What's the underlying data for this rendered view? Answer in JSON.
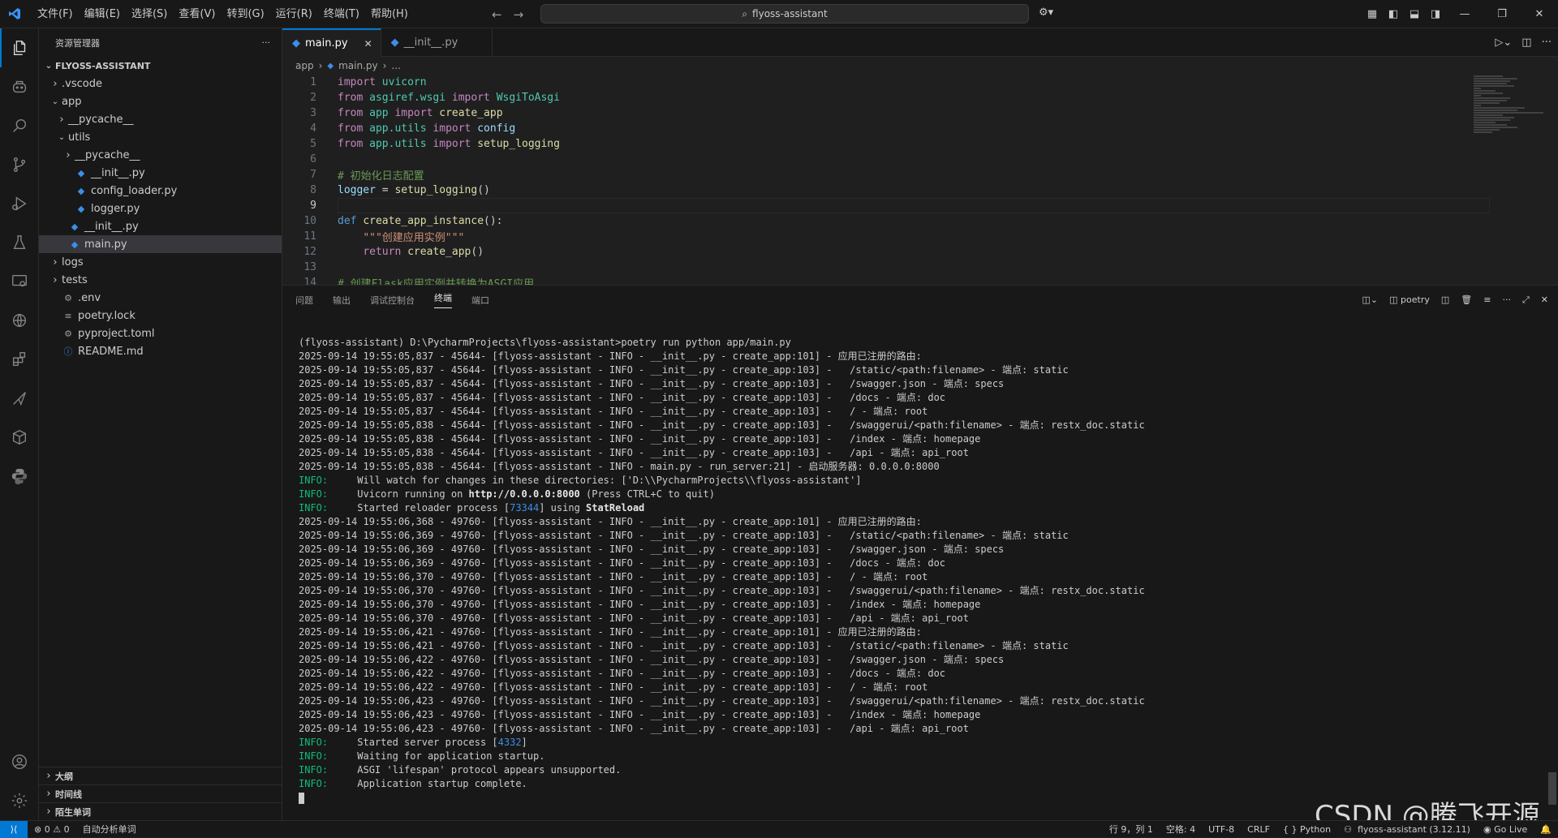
{
  "titlebar": {
    "menu": [
      "文件(F)",
      "编辑(E)",
      "选择(S)",
      "查看(V)",
      "转到(G)",
      "运行(R)",
      "终端(T)",
      "帮助(H)"
    ],
    "search": "flyoss-assistant"
  },
  "sidebar": {
    "title": "资源管理器",
    "project": "FLYOSS-ASSISTANT",
    "tree": [
      {
        "label": ".vscode",
        "type": "folder-closed",
        "depth": 0
      },
      {
        "label": "app",
        "type": "folder-open",
        "depth": 0
      },
      {
        "label": "__pycache__",
        "type": "folder-closed",
        "depth": 1
      },
      {
        "label": "utils",
        "type": "folder-open",
        "depth": 1
      },
      {
        "label": "__pycache__",
        "type": "folder-closed",
        "depth": 2
      },
      {
        "label": "__init__.py",
        "type": "py",
        "depth": 2
      },
      {
        "label": "config_loader.py",
        "type": "py",
        "depth": 2
      },
      {
        "label": "logger.py",
        "type": "py",
        "depth": 2
      },
      {
        "label": "__init__.py",
        "type": "py",
        "depth": 1
      },
      {
        "label": "main.py",
        "type": "py",
        "depth": 1,
        "selected": true
      },
      {
        "label": "logs",
        "type": "folder-closed",
        "depth": 0
      },
      {
        "label": "tests",
        "type": "folder-closed",
        "depth": 0
      },
      {
        "label": ".env",
        "type": "gear",
        "depth": 0
      },
      {
        "label": "poetry.lock",
        "type": "lines",
        "depth": 0
      },
      {
        "label": "pyproject.toml",
        "type": "gear",
        "depth": 0
      },
      {
        "label": "README.md",
        "type": "info",
        "depth": 0
      }
    ],
    "bottom_sections": [
      "大纲",
      "时间线",
      "陌生单词"
    ]
  },
  "editor": {
    "tabs": [
      {
        "label": "main.py",
        "active": true
      },
      {
        "label": "__init__.py",
        "active": false
      }
    ],
    "breadcrumb": [
      "app",
      "main.py",
      "..."
    ],
    "current_line": 9,
    "lines": [
      {
        "n": 1,
        "html": "<span class='kw'>import</span> <span class='mod'>uvicorn</span>"
      },
      {
        "n": 2,
        "html": "<span class='kw'>from</span> <span class='mod'>asgiref.wsgi</span> <span class='kw'>import</span> <span class='mod'>WsgiToAsgi</span>"
      },
      {
        "n": 3,
        "html": "<span class='kw'>from</span> <span class='mod'>app</span> <span class='kw'>import</span> <span class='fn'>create_app</span>"
      },
      {
        "n": 4,
        "html": "<span class='kw'>from</span> <span class='mod'>app.utils</span> <span class='kw'>import</span> <span class='var'>config</span>"
      },
      {
        "n": 5,
        "html": "<span class='kw'>from</span> <span class='mod'>app.utils</span> <span class='kw'>import</span> <span class='fn'>setup_logging</span>"
      },
      {
        "n": 6,
        "html": ""
      },
      {
        "n": 7,
        "html": "<span class='cmt'># 初始化日志配置</span>"
      },
      {
        "n": 8,
        "html": "<span class='var'>logger</span> = <span class='fn'>setup_logging</span>()"
      },
      {
        "n": 9,
        "html": ""
      },
      {
        "n": 10,
        "html": "<span class='kw2'>def</span> <span class='fn'>create_app_instance</span>():"
      },
      {
        "n": 11,
        "html": "    <span class='str'>\"\"\"创建应用实例\"\"\"</span>"
      },
      {
        "n": 12,
        "html": "    <span class='kw'>return</span> <span class='fn'>create_app</span>()"
      },
      {
        "n": 13,
        "html": ""
      },
      {
        "n": 14,
        "html": "<span class='cmt'># 创建Flask应用实例并转换为ASGI应用</span>"
      }
    ]
  },
  "panel": {
    "tabs": [
      "问题",
      "输出",
      "调试控制台",
      "终端",
      "端口"
    ],
    "active_tab": "终端",
    "shell": "poetry",
    "terminal_lines": [
      "(flyoss-assistant) D:\\PycharmProjects\\flyoss-assistant>poetry run python app/main.py",
      "2025-09-14 19:55:05,837 - 45644- [flyoss-assistant - INFO - __init__.py - create_app:101] - 应用已注册的路由:",
      "2025-09-14 19:55:05,837 - 45644- [flyoss-assistant - INFO - __init__.py - create_app:103] -   /static/<path:filename> - 端点: static",
      "2025-09-14 19:55:05,837 - 45644- [flyoss-assistant - INFO - __init__.py - create_app:103] -   /swagger.json - 端点: specs",
      "2025-09-14 19:55:05,837 - 45644- [flyoss-assistant - INFO - __init__.py - create_app:103] -   /docs - 端点: doc",
      "2025-09-14 19:55:05,837 - 45644- [flyoss-assistant - INFO - __init__.py - create_app:103] -   / - 端点: root",
      "2025-09-14 19:55:05,838 - 45644- [flyoss-assistant - INFO - __init__.py - create_app:103] -   /swaggerui/<path:filename> - 端点: restx_doc.static",
      "2025-09-14 19:55:05,838 - 45644- [flyoss-assistant - INFO - __init__.py - create_app:103] -   /index - 端点: homepage",
      "2025-09-14 19:55:05,838 - 45644- [flyoss-assistant - INFO - __init__.py - create_app:103] -   /api - 端点: api_root",
      "2025-09-14 19:55:05,838 - 45644- [flyoss-assistant - INFO - main.py - run_server:21] - 启动服务器: 0.0.0.0:8000",
      "INFO:     Will watch for changes in these directories: ['D:\\\\PycharmProjects\\\\flyoss-assistant']",
      "INFO:     Uvicorn running on http://0.0.0.0:8000 (Press CTRL+C to quit)",
      "INFO:     Started reloader process [73344] using StatReload",
      "2025-09-14 19:55:06,368 - 49760- [flyoss-assistant - INFO - __init__.py - create_app:101] - 应用已注册的路由:",
      "2025-09-14 19:55:06,369 - 49760- [flyoss-assistant - INFO - __init__.py - create_app:103] -   /static/<path:filename> - 端点: static",
      "2025-09-14 19:55:06,369 - 49760- [flyoss-assistant - INFO - __init__.py - create_app:103] -   /swagger.json - 端点: specs",
      "2025-09-14 19:55:06,369 - 49760- [flyoss-assistant - INFO - __init__.py - create_app:103] -   /docs - 端点: doc",
      "2025-09-14 19:55:06,370 - 49760- [flyoss-assistant - INFO - __init__.py - create_app:103] -   / - 端点: root",
      "2025-09-14 19:55:06,370 - 49760- [flyoss-assistant - INFO - __init__.py - create_app:103] -   /swaggerui/<path:filename> - 端点: restx_doc.static",
      "2025-09-14 19:55:06,370 - 49760- [flyoss-assistant - INFO - __init__.py - create_app:103] -   /index - 端点: homepage",
      "2025-09-14 19:55:06,370 - 49760- [flyoss-assistant - INFO - __init__.py - create_app:103] -   /api - 端点: api_root",
      "2025-09-14 19:55:06,421 - 49760- [flyoss-assistant - INFO - __init__.py - create_app:101] - 应用已注册的路由:",
      "2025-09-14 19:55:06,421 - 49760- [flyoss-assistant - INFO - __init__.py - create_app:103] -   /static/<path:filename> - 端点: static",
      "2025-09-14 19:55:06,422 - 49760- [flyoss-assistant - INFO - __init__.py - create_app:103] -   /swagger.json - 端点: specs",
      "2025-09-14 19:55:06,422 - 49760- [flyoss-assistant - INFO - __init__.py - create_app:103] -   /docs - 端点: doc",
      "2025-09-14 19:55:06,422 - 49760- [flyoss-assistant - INFO - __init__.py - create_app:103] -   / - 端点: root",
      "2025-09-14 19:55:06,423 - 49760- [flyoss-assistant - INFO - __init__.py - create_app:103] -   /swaggerui/<path:filename> - 端点: restx_doc.static",
      "2025-09-14 19:55:06,423 - 49760- [flyoss-assistant - INFO - __init__.py - create_app:103] -   /index - 端点: homepage",
      "2025-09-14 19:55:06,423 - 49760- [flyoss-assistant - INFO - __init__.py - create_app:103] -   /api - 端点: api_root",
      "INFO:     Started server process [4332]",
      "INFO:     Waiting for application startup.",
      "INFO:     ASGI 'lifespan' protocol appears unsupported.",
      "INFO:     Application startup complete."
    ]
  },
  "statusbar": {
    "errors": "0",
    "warnings": "0",
    "extension": "自动分析单词",
    "position": "行 9，列 1",
    "spaces": "空格: 4",
    "encoding": "UTF-8",
    "eol": "CRLF",
    "language": "Python",
    "interpreter": "flyoss-assistant (3.12.11)",
    "golive": "Go Live"
  },
  "watermark": "CSDN @腾飞开源",
  "colors": {
    "accent": "#0078d4",
    "info": "#0dbc79",
    "link": "#3b8eea"
  }
}
